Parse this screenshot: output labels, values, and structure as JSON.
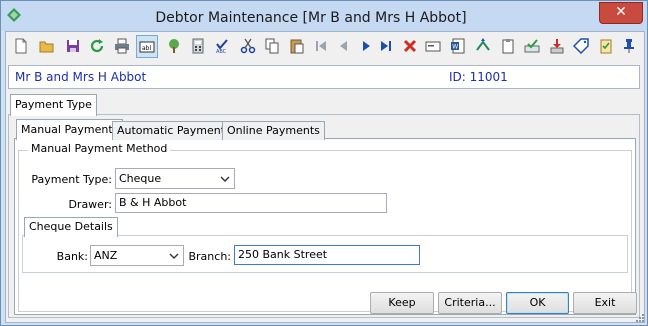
{
  "window": {
    "title": "Debtor Maintenance  [Mr B and Mrs H Abbot]",
    "close_glyph": "✕"
  },
  "toolbar": {
    "icons": [
      "new-icon",
      "open-folder-icon",
      "save-icon",
      "refresh-icon",
      "print-icon",
      "text-field-icon",
      "tree-icon",
      "calculator-icon",
      "spellcheck-icon",
      "cut-icon",
      "copy-icon",
      "paste-icon",
      "first-record-icon",
      "previous-record-icon",
      "next-record-icon",
      "last-record-icon",
      "delete-icon",
      "card-icon",
      "word-document-icon",
      "route-icon",
      "clipboard-icon",
      "approve-icon",
      "download-icon",
      "tag-icon",
      "checklist-icon",
      "pin-icon"
    ]
  },
  "info": {
    "name": "Mr B and Mrs H Abbot",
    "id": "ID: 11001"
  },
  "outer_tab": {
    "label": "Payment Type"
  },
  "tabs": [
    {
      "label": "Manual Payments"
    },
    {
      "label": "Automatic Payments"
    },
    {
      "label": "Online Payments"
    }
  ],
  "manual": {
    "group_label": "Manual Payment Method",
    "payment_type_label": "Payment Type:",
    "payment_type_value": "Cheque",
    "drawer_label": "Drawer:",
    "drawer_value": "B & H Abbot"
  },
  "cheque": {
    "tab_label": "Cheque Details",
    "bank_label": "Bank:",
    "bank_value": "ANZ",
    "branch_label": "Branch:",
    "branch_value": "250 Bank Street"
  },
  "buttons": {
    "keep": "Keep",
    "criteria": "Criteria...",
    "ok": "OK",
    "exit": "Exit"
  },
  "colors": {
    "accent_text": "#1e2fa8",
    "title_bar": "#c5daf2",
    "close": "#c94a3f"
  }
}
